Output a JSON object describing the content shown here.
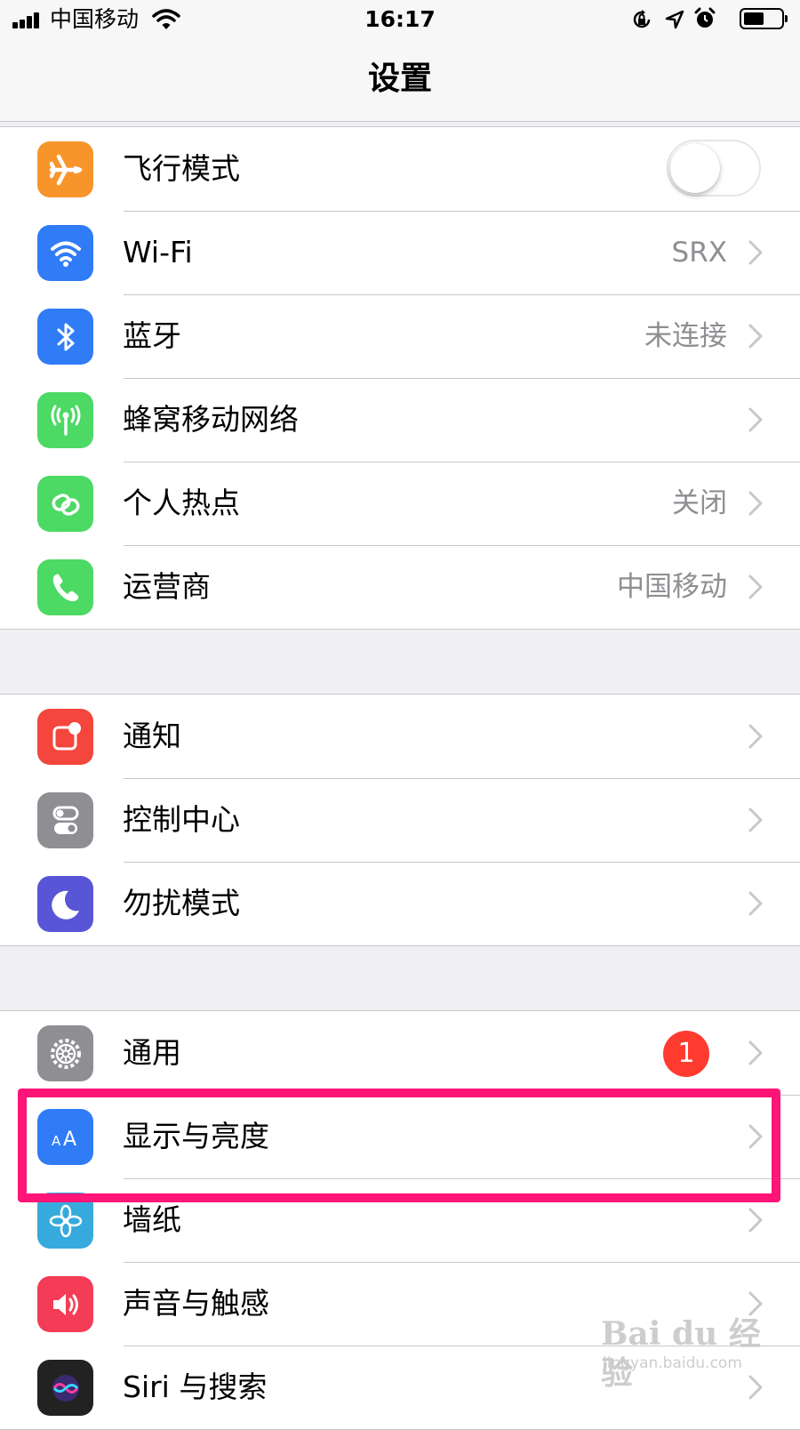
{
  "status_bar": {
    "carrier": "中国移动",
    "time": "16:17"
  },
  "nav": {
    "title": "设置"
  },
  "groups": [
    {
      "rows": [
        {
          "label": "飞行模式",
          "icon": "airplane-icon",
          "color": "#f7952b",
          "toggle": "off"
        },
        {
          "label": "Wi-Fi",
          "value": "SRX",
          "icon": "wifi-icon",
          "color": "#2f7cf6"
        },
        {
          "label": "蓝牙",
          "value": "未连接",
          "icon": "bluetooth-icon",
          "color": "#2f7cf6"
        },
        {
          "label": "蜂窝移动网络",
          "icon": "cellular-icon",
          "color": "#4cd964"
        },
        {
          "label": "个人热点",
          "value": "关闭",
          "icon": "hotspot-icon",
          "color": "#4cd964"
        },
        {
          "label": "运营商",
          "value": "中国移动",
          "icon": "phone-icon",
          "color": "#4cd964"
        }
      ]
    },
    {
      "rows": [
        {
          "label": "通知",
          "icon": "notifications-icon",
          "color": "#f4463c"
        },
        {
          "label": "控制中心",
          "icon": "control-center-icon",
          "color": "#8e8e93"
        },
        {
          "label": "勿扰模式",
          "icon": "moon-icon",
          "color": "#5856d6"
        }
      ]
    },
    {
      "rows": [
        {
          "label": "通用",
          "badge": "1",
          "icon": "gear-icon",
          "color": "#8e8e93"
        },
        {
          "label": "显示与亮度",
          "icon": "display-brightness-icon",
          "color": "#2f7cf6",
          "highlighted": true
        },
        {
          "label": "墙纸",
          "icon": "wallpaper-icon",
          "color": "#36aadc"
        },
        {
          "label": "声音与触感",
          "icon": "sound-icon",
          "color": "#f43c57"
        },
        {
          "label": "Siri 与搜索",
          "icon": "siri-icon",
          "color": "#222222"
        }
      ]
    }
  ],
  "watermark": {
    "brand": "Bai du 经验",
    "url": "jingyan.baidu.com"
  }
}
